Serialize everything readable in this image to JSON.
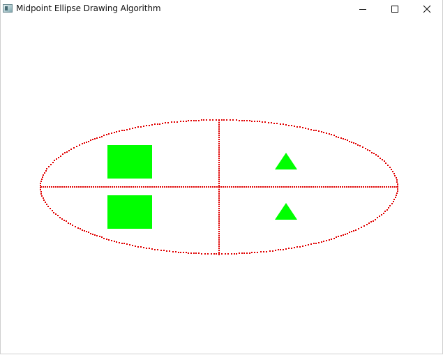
{
  "window": {
    "title": "Midpoint Ellipse Drawing Algorithm",
    "icon": "app-window-icon",
    "controls": {
      "minimize_icon": "minimize-icon",
      "maximize_icon": "maximize-icon",
      "close_icon": "close-icon"
    }
  },
  "drawing": {
    "background": "#ffffff",
    "ellipse_color": "#e00000",
    "axis_color": "#e00000",
    "shape_color": "#00ff00",
    "shapes": [
      {
        "kind": "square",
        "quadrant": "top-left"
      },
      {
        "kind": "triangle",
        "quadrant": "top-right"
      },
      {
        "kind": "square",
        "quadrant": "bottom-left"
      },
      {
        "kind": "triangle",
        "quadrant": "bottom-right"
      }
    ]
  }
}
